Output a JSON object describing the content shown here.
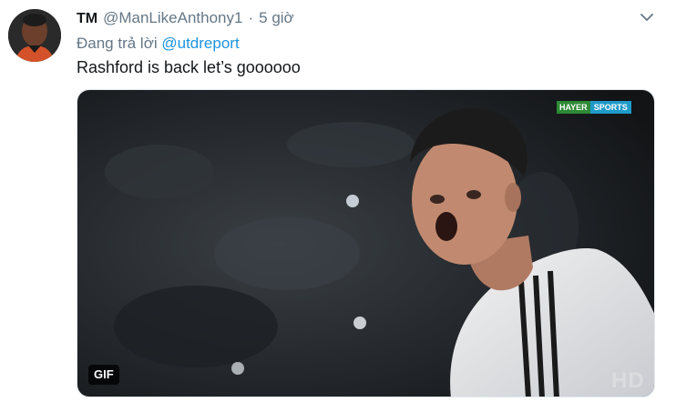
{
  "tweet": {
    "display_name": "TM",
    "handle": "@ManLikeAnthony1",
    "separator": "·",
    "time": "5 giờ",
    "reply_prefix": "Đang trả lời",
    "reply_to": "@utdreport",
    "text": "Rashford is back let’s goooooo"
  },
  "media": {
    "badge": "GIF",
    "watermark_left": "HAYER",
    "watermark_right": "SPORTS",
    "corner_mark": "HD"
  },
  "icons": {
    "caret": "chevron-down-icon",
    "avatar": "avatar"
  },
  "colors": {
    "link": "#1b95e0",
    "muted": "#657786",
    "text": "#14171a"
  }
}
